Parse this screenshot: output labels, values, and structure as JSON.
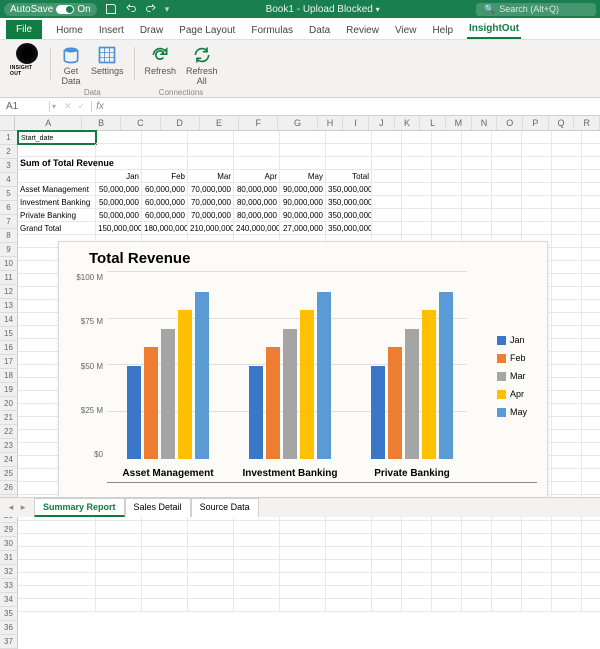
{
  "titlebar": {
    "autosave_label": "AutoSave",
    "autosave_state": "On",
    "doc_title": "Book1 - Upload Blocked",
    "search_placeholder": "Search (Alt+Q)"
  },
  "tabs": [
    "File",
    "Home",
    "Insert",
    "Draw",
    "Page Layout",
    "Formulas",
    "Data",
    "Review",
    "View",
    "Help",
    "InsightOut"
  ],
  "active_tab": 10,
  "ribbon": {
    "logo_label": "INSIGHT OUT",
    "get_data": "Get\nData",
    "settings": "Settings",
    "refresh": "Refresh",
    "refresh_all": "Refresh\nAll",
    "group_data": "Data",
    "group_conn": "Connections"
  },
  "formula_bar": {
    "namebox": "A1",
    "value": ""
  },
  "grid": {
    "columns": [
      "A",
      "B",
      "C",
      "D",
      "E",
      "F",
      "G",
      "H",
      "I",
      "J",
      "K",
      "L",
      "M",
      "N",
      "O",
      "P",
      "Q",
      "R"
    ],
    "a1": "Start_date",
    "pivot_title": "Sum of Total Revenue",
    "headers": [
      "",
      "Jan",
      "Feb",
      "Mar",
      "Apr",
      "May",
      "Total"
    ],
    "rows": [
      [
        "Asset Management",
        "50,000,000",
        "60,000,000",
        "70,000,000",
        "80,000,000",
        "90,000,000",
        "350,000,000"
      ],
      [
        "Investment Banking",
        "50,000,000",
        "60,000,000",
        "70,000,000",
        "80,000,000",
        "90,000,000",
        "350,000,000"
      ],
      [
        "Private Banking",
        "50,000,000",
        "60,000,000",
        "70,000,000",
        "80,000,000",
        "90,000,000",
        "350,000,000"
      ],
      [
        "Grand Total",
        "150,000,000",
        "180,000,000",
        "210,000,000",
        "240,000,000",
        "27,000,000",
        "350,000,000"
      ]
    ]
  },
  "chart_data": {
    "type": "bar",
    "title": "Total Revenue",
    "ylabel": "",
    "ylim": [
      0,
      100
    ],
    "y_ticks": [
      "$100 M",
      "$75 M",
      "$50 M",
      "$25 M",
      "$0"
    ],
    "categories": [
      "Asset Management",
      "Investment Banking",
      "Private Banking"
    ],
    "series": [
      {
        "name": "Jan",
        "color": "#3a77c9",
        "values": [
          50,
          50,
          50
        ]
      },
      {
        "name": "Feb",
        "color": "#ed7d31",
        "values": [
          60,
          60,
          60
        ]
      },
      {
        "name": "Mar",
        "color": "#a5a5a5",
        "values": [
          70,
          70,
          70
        ]
      },
      {
        "name": "Apr",
        "color": "#ffc000",
        "values": [
          80,
          80,
          80
        ]
      },
      {
        "name": "May",
        "color": "#5b9bd5",
        "values": [
          90,
          90,
          90
        ]
      }
    ]
  },
  "sheets": [
    "Summary Report",
    "Sales Detail",
    "Source Data"
  ],
  "active_sheet": 0
}
